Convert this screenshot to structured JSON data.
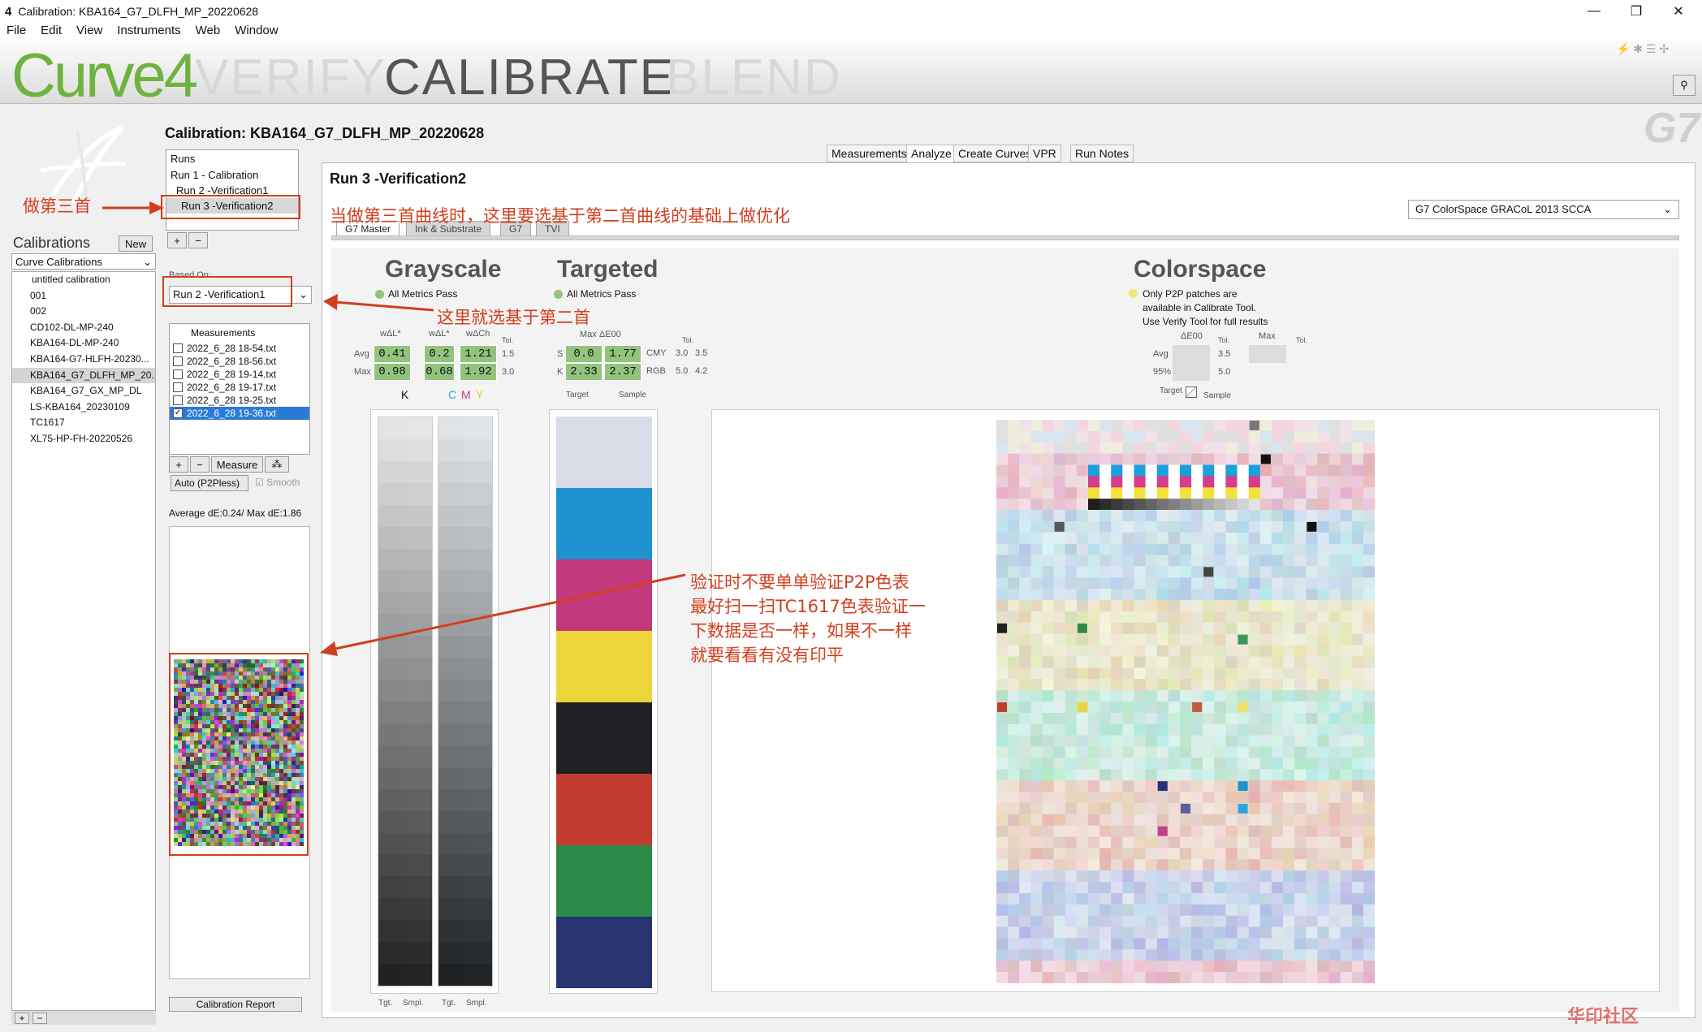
{
  "window": {
    "title": "Calibration: KBA164_G7_DLFH_MP_20220628",
    "minimize": "—",
    "maximize": "❐",
    "close": "✕"
  },
  "menu": [
    "File",
    "Edit",
    "View",
    "Instruments",
    "Web",
    "Window"
  ],
  "brand": {
    "logo": "Curve4",
    "tabs": [
      "VERIFY",
      "CALIBRATE",
      "BLEND"
    ],
    "g7": "G7"
  },
  "left": {
    "calibrations_label": "Calibrations",
    "new_button": "New",
    "dropdown": "Curve Calibrations",
    "items": [
      "untitled calibration",
      "001",
      "002",
      "CD102-DL-MP-240",
      "KBA164-DL-MP-240",
      "KBA164-G7-HLFH-20230...",
      "KBA164_G7_DLFH_MP_20...",
      "KBA164_G7_GX_MP_DL",
      "LS-KBA164_20230109",
      "TC1617",
      "XL75-HP-FH-20220526"
    ],
    "selected_index": 6
  },
  "calibration_title": "Calibration: KBA164_G7_DLFH_MP_20220628",
  "runs": {
    "header": "Runs",
    "items": [
      "Run 1 - Calibration",
      "Run 2 -Verification1",
      "Run 3 -Verification2"
    ],
    "selected_index": 2
  },
  "based_on": {
    "label": "Based On:",
    "value": "Run 2 -Verification1"
  },
  "measurements": {
    "header": "Measurements",
    "items": [
      "2022_6_28 18-54.txt",
      "2022_6_28 18-56.txt",
      "2022_6_28 19-14.txt",
      "2022_6_28 19-17.txt",
      "2022_6_28 19-25.txt",
      "2022_6_28 19-36.txt"
    ],
    "checked_index": 5,
    "measure_button": "Measure",
    "mode": "Auto (P2Pless)",
    "smooth": "Smooth",
    "average": "Average dE:0.24/ Max dE:1.86",
    "report_button": "Calibration Report"
  },
  "tabs": [
    "Measurements",
    "Analyze",
    "Create Curves",
    "VPR",
    "Run Notes"
  ],
  "active_tab": "Analyze",
  "run_title": "Run 3 -Verification2",
  "sub_tabs": [
    "G7 Master",
    "Ink & Substrate",
    "G7",
    "TVI"
  ],
  "colorspace_select": "G7 ColorSpace GRACoL 2013 SCCA",
  "grayscale": {
    "title": "Grayscale",
    "status": "All Metrics Pass",
    "headers": [
      "wΔL*",
      "wΔL*",
      "wΔCh",
      "Tol."
    ],
    "rows": [
      {
        "label": "Avg",
        "v1": "0.41",
        "v2": "0.2",
        "v3": "1.21",
        "tol": "1.5"
      },
      {
        "label": "Max",
        "v1": "0.98",
        "v2": "0.68",
        "v3": "1.92",
        "tol": "3.0"
      }
    ],
    "col_k": "K",
    "col_c": "C",
    "col_m": "M",
    "col_y": "Y",
    "foot": [
      "Tgt.",
      "Smpl.",
      "Tgt.",
      "Smpl."
    ]
  },
  "targeted": {
    "title": "Targeted",
    "status": "All Metrics Pass",
    "header": "Max ΔE00",
    "tol": "Tol.",
    "rows": [
      {
        "label": "S",
        "v1": "0.0",
        "v2": "1.77",
        "name": "CMY",
        "t1": "3.0",
        "t2": "3.5"
      },
      {
        "label": "K",
        "v1": "2.33",
        "v2": "2.37",
        "name": "RGB",
        "t1": "5.0",
        "t2": "4.2"
      }
    ],
    "col_target": "Target",
    "col_sample": "Sample",
    "swatches": [
      "#d9dce6",
      "#1f93d0",
      "#c23a7c",
      "#ecd53a",
      "#1f2024",
      "#c23d30",
      "#2e8a4a",
      "#27346f"
    ]
  },
  "colorspace": {
    "title": "Colorspace",
    "note": [
      "Only P2P patches are",
      "available in Calibrate Tool.",
      "Use Verify Tool for full results"
    ],
    "headers": [
      "ΔE00",
      "Tol.",
      "Max",
      "Tol."
    ],
    "rows": [
      {
        "label": "Avg",
        "tol": "3.5"
      },
      {
        "label": "95%",
        "tol": "5.0"
      }
    ],
    "target": "Target",
    "sample": "Sample"
  },
  "annotations": {
    "a1": "做第三首",
    "a2": "当做第三首曲线时，这里要选基于第二首曲线的基础上做优化",
    "a3": "这里就选基于第二首",
    "a4": [
      "验证时不要单单验证P2P色表",
      "最好扫一扫TC1617色表验证一",
      "下数据是否一样，如果不一样",
      "就要看看有没有印平"
    ]
  },
  "watermark": "华印社区"
}
